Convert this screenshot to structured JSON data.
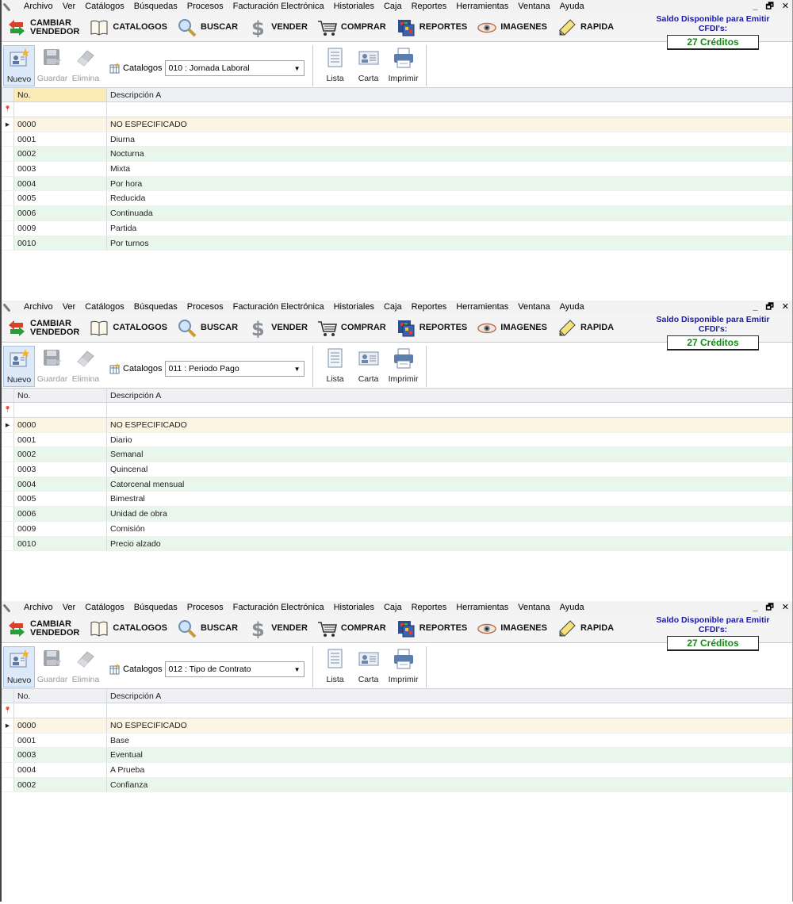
{
  "menu": [
    "Archivo",
    "Ver",
    "Catálogos",
    "Búsquedas",
    "Procesos",
    "Facturación Electrónica",
    "Historiales",
    "Caja",
    "Reportes",
    "Herramientas",
    "Ventana",
    "Ayuda"
  ],
  "window_controls": {
    "minimize": "_",
    "restore": "🗗",
    "close": "✕"
  },
  "bigbar": [
    {
      "id": "cambiar",
      "label": "CAMBIAR\nVENDEDOR",
      "icon": "swap-arrows-icon"
    },
    {
      "id": "catalogos",
      "label": "CATALOGOS",
      "icon": "book-icon"
    },
    {
      "id": "buscar",
      "label": "BUSCAR",
      "icon": "magnifier-icon"
    },
    {
      "id": "vender",
      "label": "VENDER",
      "icon": "dollar-icon"
    },
    {
      "id": "comprar",
      "label": "COMPRAR",
      "icon": "cart-icon"
    },
    {
      "id": "reportes",
      "label": "REPORTES",
      "icon": "report-icon"
    },
    {
      "id": "imagenes",
      "label": "IMAGENES",
      "icon": "eye-icon"
    },
    {
      "id": "rapida",
      "label": "RAPIDA",
      "icon": "pencil-icon"
    }
  ],
  "credits": {
    "title": "Saldo Disponible para Emitir CFDI's:",
    "value": "27 Créditos"
  },
  "toolbar": {
    "nuevo": "Nuevo",
    "guardar": "Guardar",
    "elimina": "Elimina",
    "catalog_label": "Catalogos",
    "lista": "Lista",
    "carta": "Carta",
    "imprimir": "Imprimir"
  },
  "grid_header": {
    "no": "No.",
    "desc": "Descripción A"
  },
  "panels": [
    {
      "catalog": "010 : Jornada Laboral",
      "rows": [
        {
          "no": "0000",
          "desc": "NO ESPECIFICADO"
        },
        {
          "no": "0001",
          "desc": "Diurna"
        },
        {
          "no": "0002",
          "desc": "Nocturna"
        },
        {
          "no": "0003",
          "desc": "Mixta"
        },
        {
          "no": "0004",
          "desc": "Por hora"
        },
        {
          "no": "0005",
          "desc": "Reducida"
        },
        {
          "no": "0006",
          "desc": "Continuada"
        },
        {
          "no": "0009",
          "desc": "Partida"
        },
        {
          "no": "0010",
          "desc": "Por turnos"
        }
      ]
    },
    {
      "catalog": "011 : Periodo Pago",
      "rows": [
        {
          "no": "0000",
          "desc": "NO ESPECIFICADO"
        },
        {
          "no": "0001",
          "desc": "Diario"
        },
        {
          "no": "0002",
          "desc": "Semanal"
        },
        {
          "no": "0003",
          "desc": "Quincenal"
        },
        {
          "no": "0004",
          "desc": "Catorcenal mensual"
        },
        {
          "no": "0005",
          "desc": "Bimestral"
        },
        {
          "no": "0006",
          "desc": "Unidad de obra"
        },
        {
          "no": "0009",
          "desc": "Comisión"
        },
        {
          "no": "0010",
          "desc": "Precio alzado"
        }
      ]
    },
    {
      "catalog": "012 : Tipo de Contrato",
      "rows": [
        {
          "no": "0000",
          "desc": "NO ESPECIFICADO"
        },
        {
          "no": "0001",
          "desc": "Base"
        },
        {
          "no": "0003",
          "desc": "Eventual"
        },
        {
          "no": "0004",
          "desc": "A Prueba"
        },
        {
          "no": "0002",
          "desc": "Confianza"
        }
      ]
    }
  ]
}
